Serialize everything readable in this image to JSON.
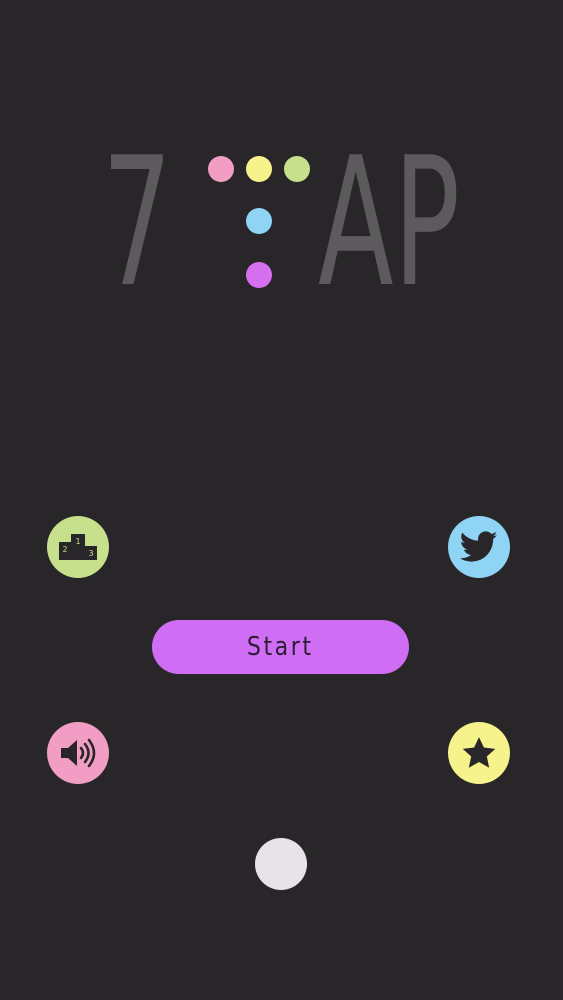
{
  "logo": {
    "left_letter": "7",
    "right_letters": "AP",
    "dot_colors": [
      "#f29ec4",
      "#f7f38c",
      "#c6e08c",
      "#8fd3f5",
      "#d66ff0"
    ]
  },
  "buttons": {
    "leaderboard": {
      "icon": "podium-icon",
      "color": "#c6e08c",
      "podium_numbers": [
        "2",
        "1",
        "3"
      ]
    },
    "twitter": {
      "icon": "twitter-bird-icon",
      "color": "#8fd3f5"
    },
    "start": {
      "label": "Start",
      "color": "#cf6ef4"
    },
    "sound": {
      "icon": "speaker-icon",
      "color": "#f29ec4"
    },
    "rate": {
      "icon": "star-icon",
      "color": "#f7f38c"
    }
  },
  "bottom_circle": {
    "color": "#e6e4e6"
  },
  "colors": {
    "background": "#282628",
    "logo_text": "#5c5a5c",
    "icon_ink": "#282628"
  }
}
